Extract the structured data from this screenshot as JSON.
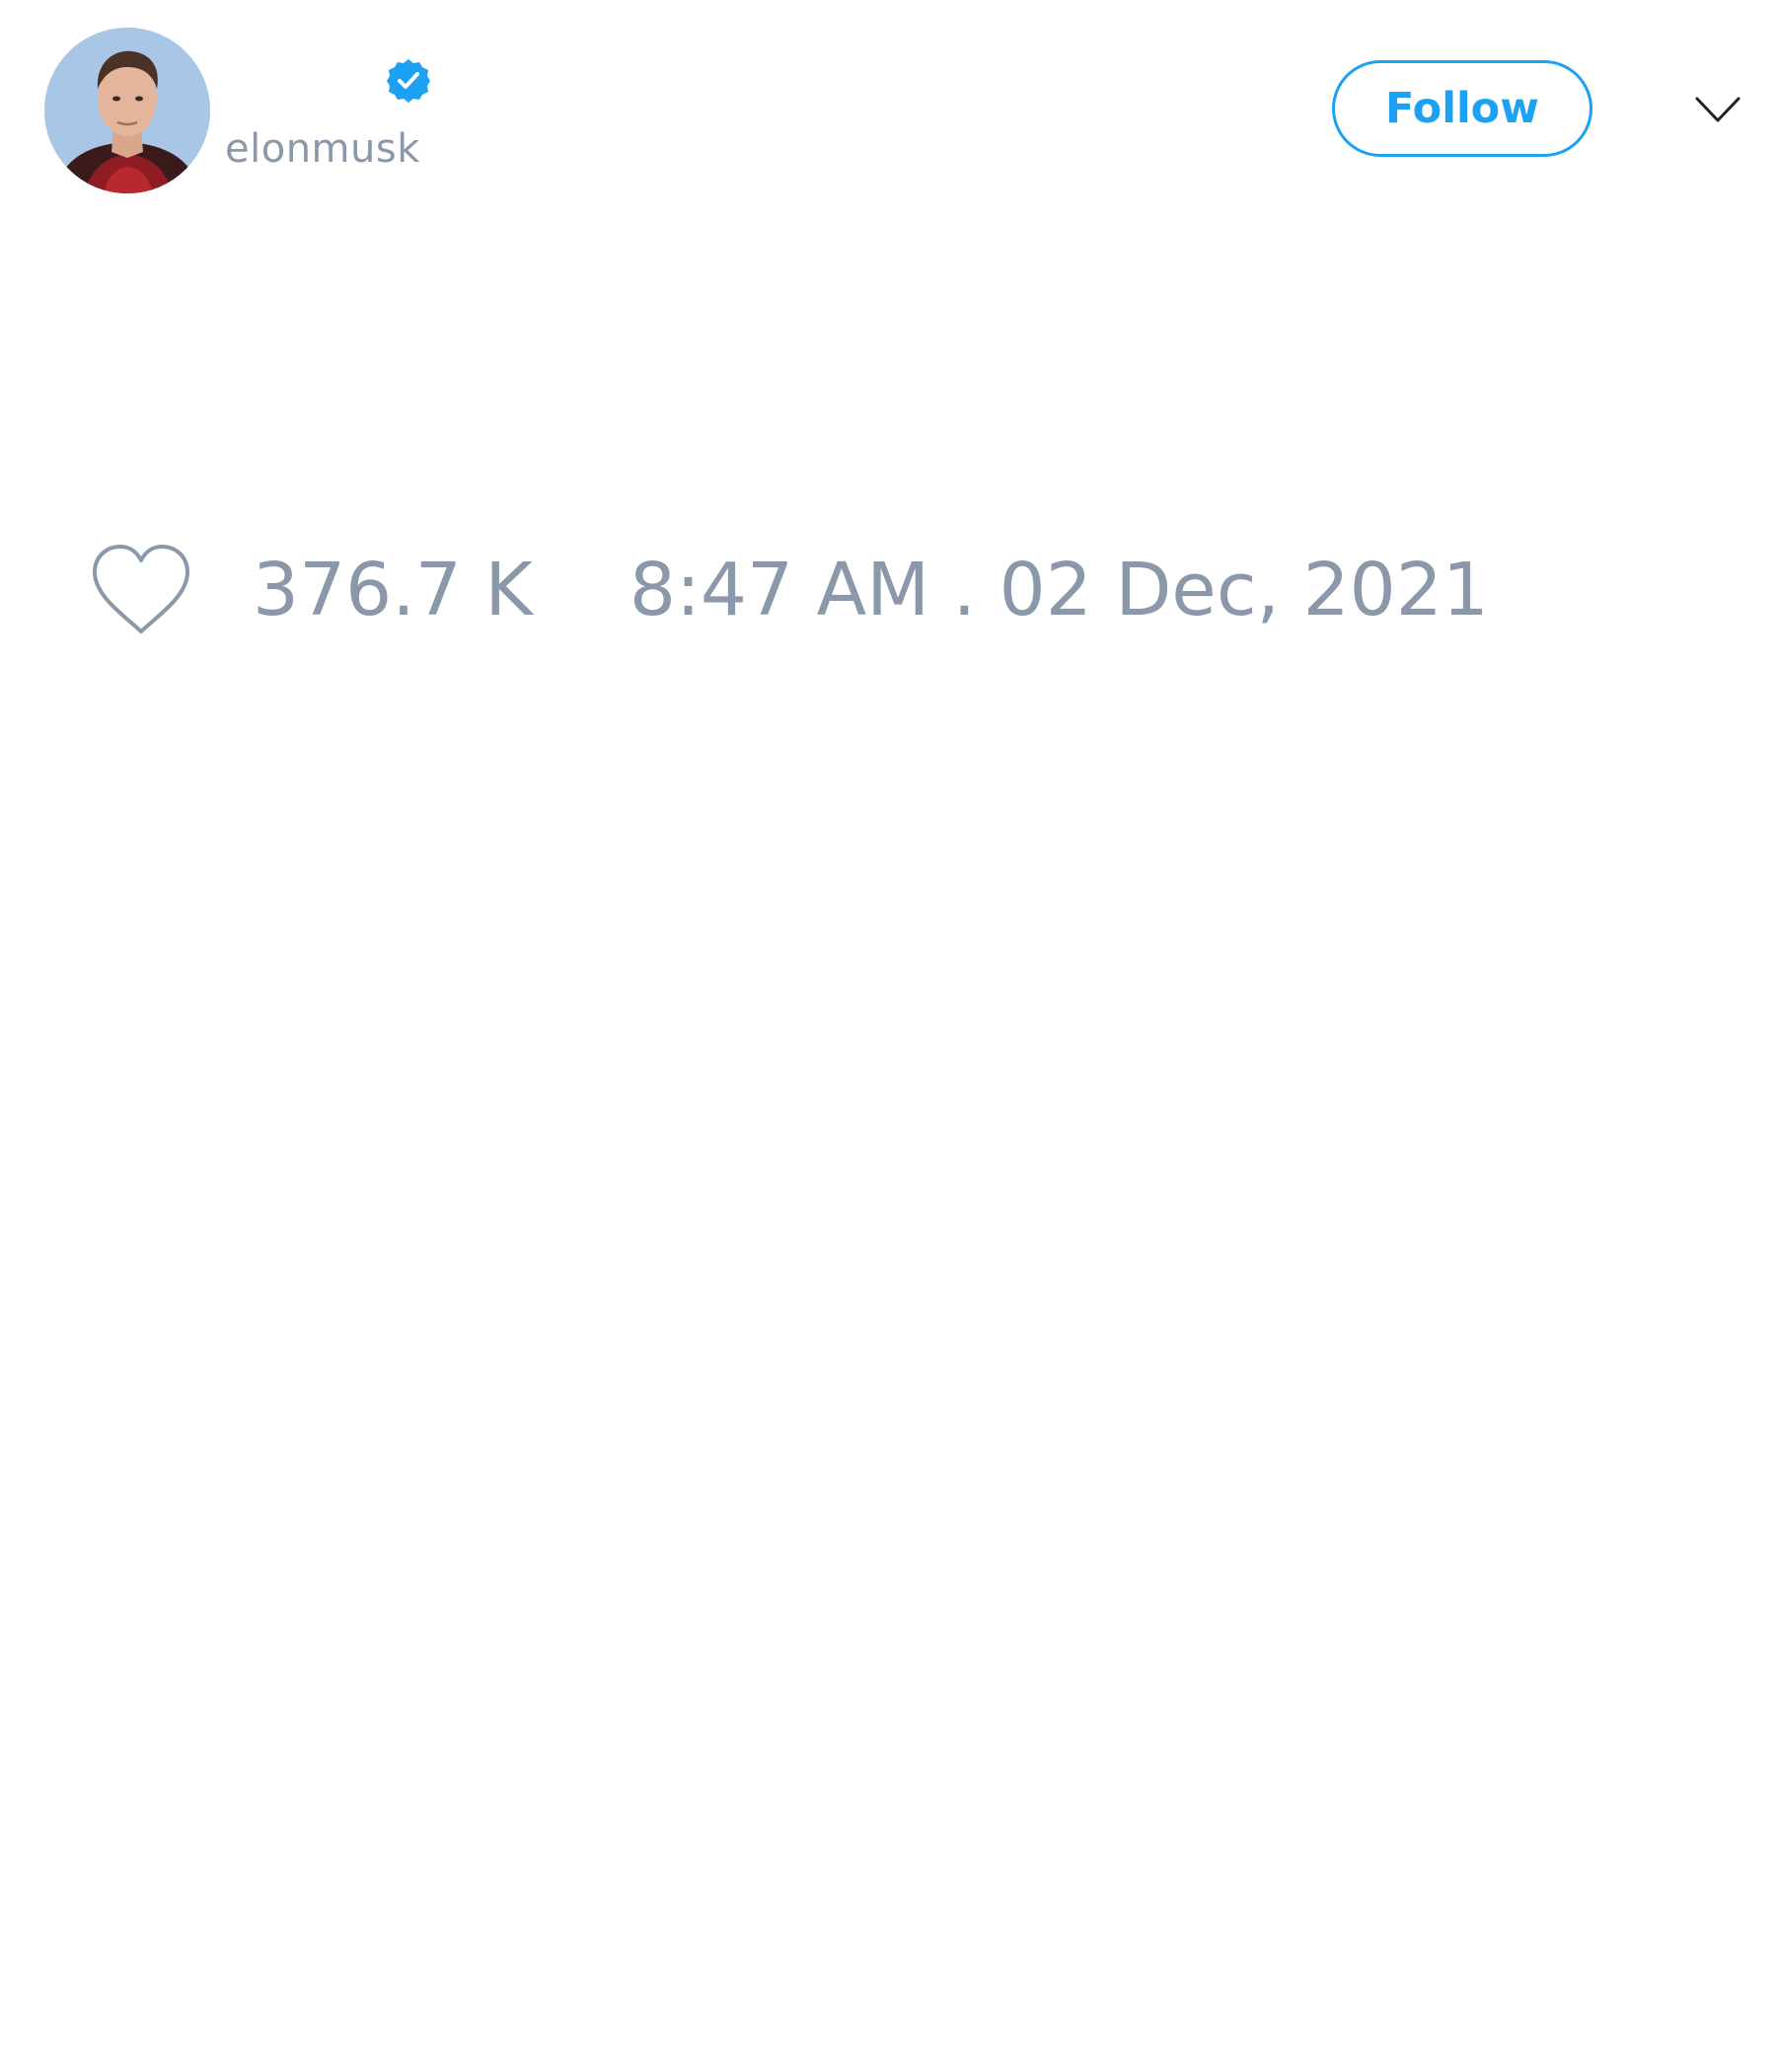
{
  "tweet": {
    "handle": "elonmusk",
    "follow_label": "Follow",
    "likes": "376.7 K",
    "timestamp": "8:47 AM . 02 Dec, 2021"
  },
  "icons": {
    "verified": "verified-badge-icon",
    "like": "heart-icon",
    "menu": "chevron-down-icon"
  },
  "colors": {
    "accent": "#1da1f2",
    "muted_text": "#8b98a9",
    "background": "#ffffff"
  }
}
